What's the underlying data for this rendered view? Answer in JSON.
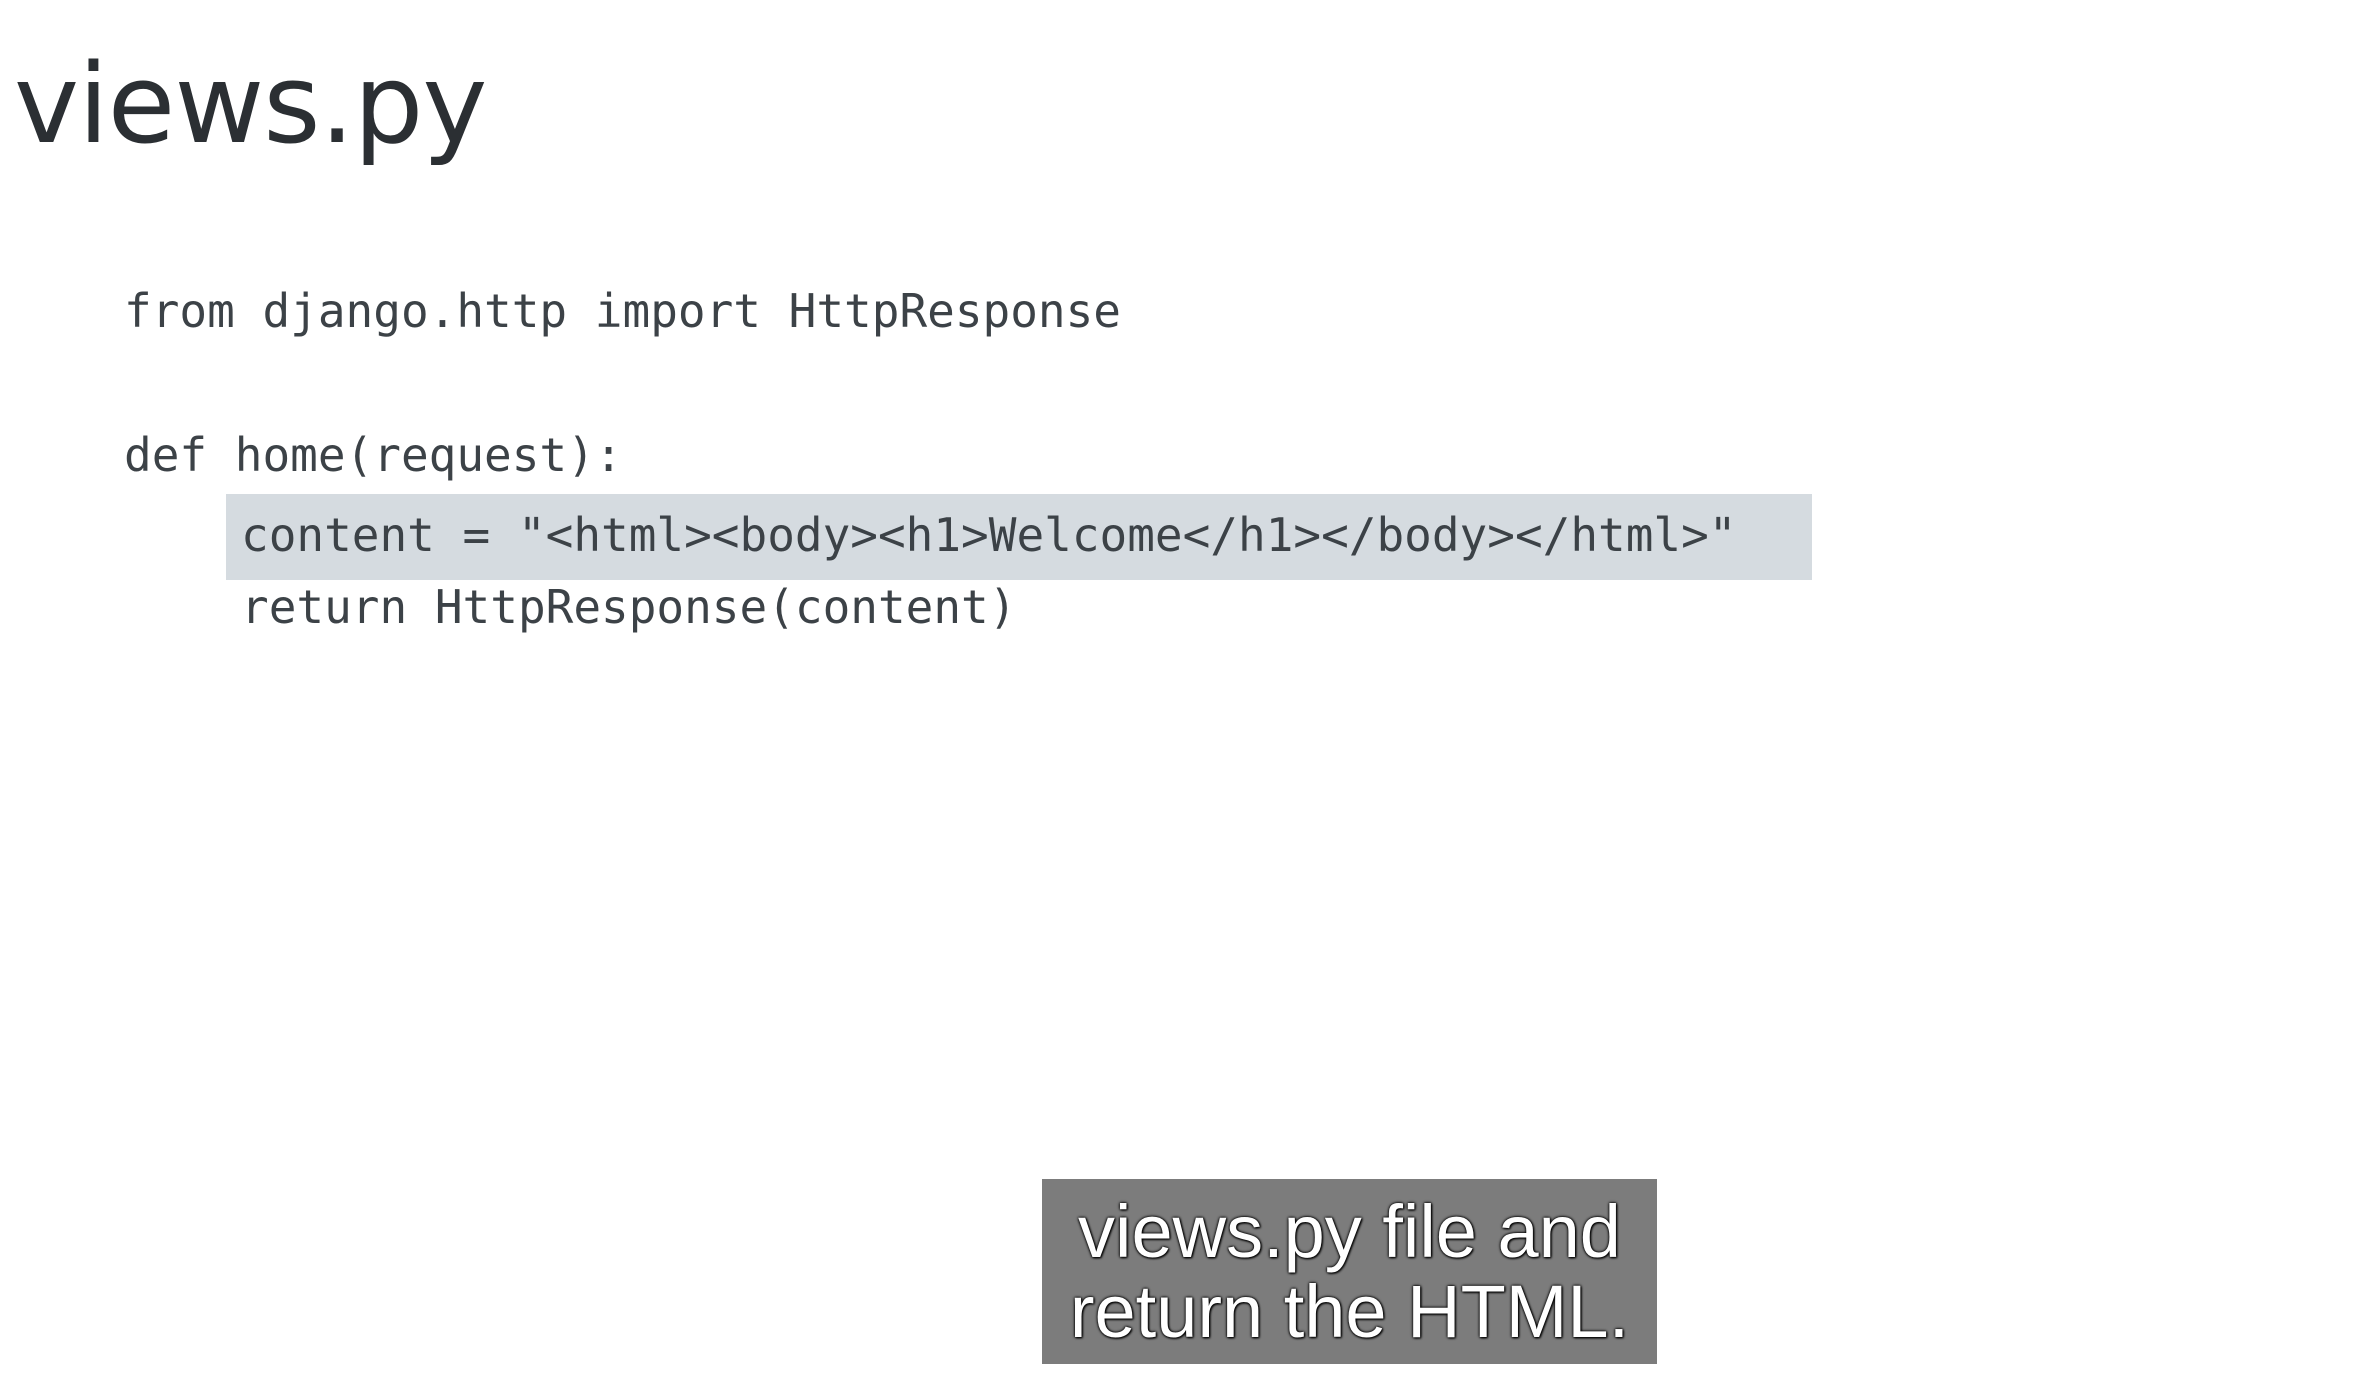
{
  "slide": {
    "title": "views.py"
  },
  "code": {
    "lines": [
      "from django.http import HttpResponse",
      "",
      "def home(request):",
      "content = \"<html><body><h1>Welcome</h1></body></html>\"",
      "return HttpResponse(content)"
    ],
    "highlighted_line_index": 3
  },
  "caption": {
    "lines": [
      "views.py file and",
      "return the HTML."
    ]
  },
  "colors": {
    "highlight": "#d5dbe0",
    "caption_background": "#7c7c7c",
    "code_text": "#3c4247",
    "title_text": "#2b2f33"
  }
}
